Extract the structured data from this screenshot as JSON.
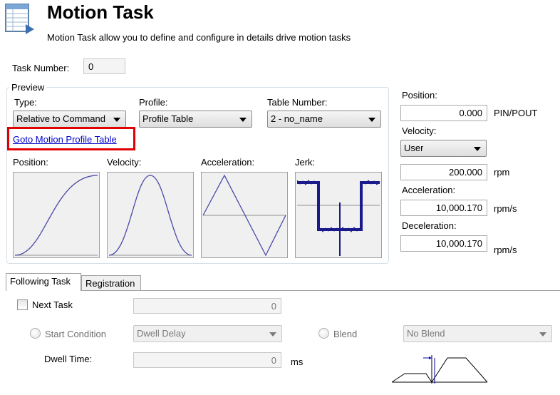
{
  "header": {
    "title": "Motion Task",
    "subtitle": "Motion Task allow you to define and configure in details drive motion tasks",
    "icon": "table-icon"
  },
  "task_number": {
    "label": "Task Number:",
    "value": "0"
  },
  "preview": {
    "group_label": "Preview",
    "type": {
      "label": "Type:",
      "value": "Relative to Command"
    },
    "profile": {
      "label": "Profile:",
      "value": "Profile Table"
    },
    "table_number": {
      "label": "Table Number:",
      "value": "2 - no_name"
    },
    "goto_link": "Goto Motion Profile Table",
    "plots": {
      "position": "Position:",
      "velocity": "Velocity:",
      "acceleration": "Acceleration:",
      "jerk": "Jerk:"
    }
  },
  "params": {
    "position": {
      "label": "Position:",
      "value": "0.000",
      "unit": "PIN/POUT"
    },
    "velocity": {
      "label": "Velocity:",
      "mode": "User",
      "value": "200.000",
      "unit": "rpm"
    },
    "acceleration": {
      "label": "Acceleration:",
      "value": "10,000.170",
      "unit": "rpm/s"
    },
    "deceleration": {
      "label": "Deceleration:",
      "value": "10,000.170",
      "unit": "rpm/s"
    }
  },
  "tabs": [
    {
      "label": "Following Task",
      "active": true
    },
    {
      "label": "Registration",
      "active": false
    }
  ],
  "following": {
    "next_task": {
      "label": "Next Task",
      "checked": false,
      "value": "0"
    },
    "start_condition": {
      "label": "Start Condition",
      "value": "Dwell Delay"
    },
    "blend": {
      "label": "Blend",
      "value": "No Blend"
    },
    "dwell_time": {
      "label": "Dwell Time:",
      "value": "0",
      "unit": "ms"
    }
  },
  "colors": {
    "curve": "#4a4aa8",
    "jerk_signal": "#1a1a8c",
    "highlight": "#e00000",
    "link": "#0000cc"
  }
}
